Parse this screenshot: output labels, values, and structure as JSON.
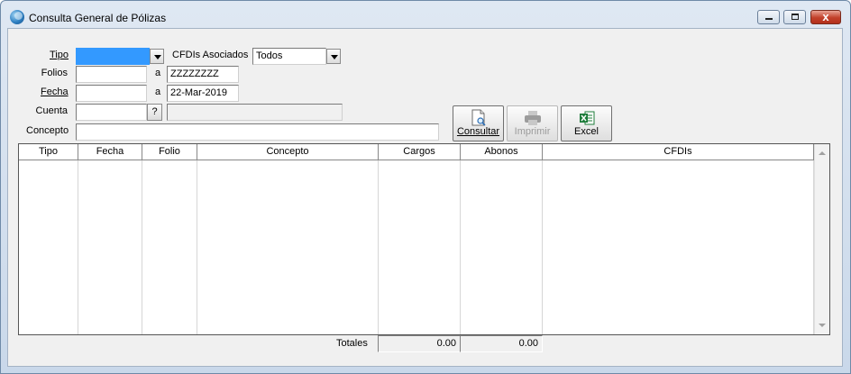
{
  "window": {
    "title": "Consulta General de Pólizas",
    "icon": "app-logo-icon",
    "controls": {
      "minimize": "minimize-icon",
      "maximize": "maximize-icon",
      "close": "close-icon",
      "close_glyph": "x"
    }
  },
  "filters": {
    "tipo": {
      "label": "Tipo",
      "value": "",
      "highlight_color": "#3399ff"
    },
    "cfdis": {
      "label": "CFDIs Asociados",
      "value": "Todos"
    },
    "folios": {
      "label": "Folios",
      "from": "",
      "sep": "a",
      "to": "ZZZZZZZZ"
    },
    "fecha": {
      "label": "Fecha",
      "from": "",
      "sep": "a",
      "to": "22-Mar-2019"
    },
    "cuenta": {
      "label": "Cuenta",
      "value": "",
      "lookup": "?",
      "description": ""
    },
    "concepto": {
      "label": "Concepto",
      "value": ""
    }
  },
  "actions": {
    "consultar": {
      "label": "Consultar",
      "icon": "document-search-icon"
    },
    "imprimir": {
      "label": "Imprimir",
      "icon": "printer-icon",
      "enabled": false
    },
    "excel": {
      "label": "Excel",
      "icon": "excel-icon",
      "color": "#1d7c3a"
    }
  },
  "grid": {
    "columns": [
      "Tipo",
      "Fecha",
      "Folio",
      "Concepto",
      "Cargos",
      "Abonos",
      "CFDIs"
    ],
    "rows": []
  },
  "totals": {
    "label": "Totales",
    "cargos": "0.00",
    "abonos": "0.00"
  }
}
